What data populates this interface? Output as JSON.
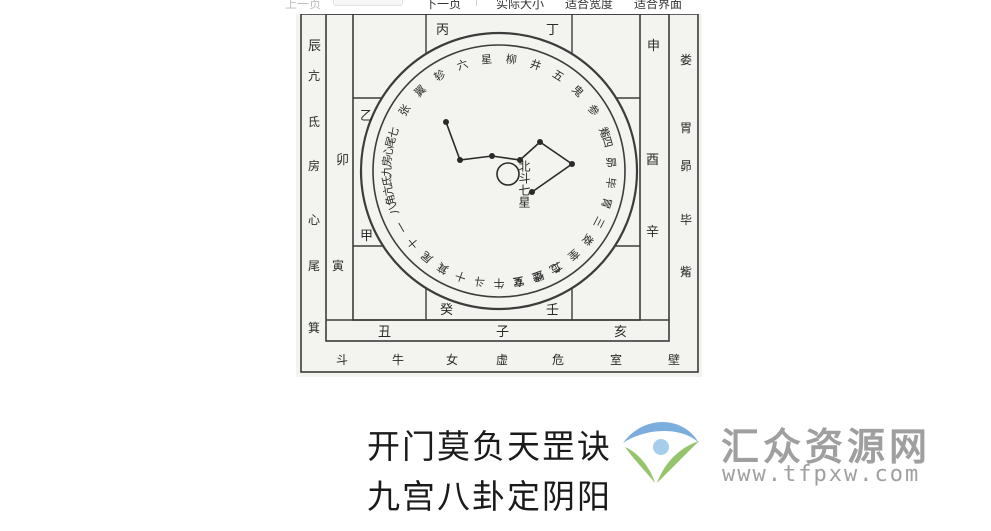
{
  "toolbar": {
    "prev_page": "上一页",
    "next_page": "下一页",
    "actual_size": "实际大小",
    "fit_width": "适合宽度",
    "fit_page": "适合界面"
  },
  "diagram": {
    "top_branch": "丁",
    "top_left_branch": "丙",
    "left_stems": [
      "乙",
      "卯",
      "甲"
    ],
    "right_stems": [
      "酉",
      "辛"
    ],
    "bottom_stems": [
      "丑",
      "子",
      "亥",
      "癸",
      "壬"
    ],
    "top_right_corner": "申",
    "top_left_corner": "辰",
    "left_mansions": [
      "亢",
      "氐",
      "房",
      "心",
      "尾",
      "寅",
      "箕"
    ],
    "right_mansions": [
      "娄",
      "胃",
      "昴",
      "毕",
      "觜"
    ],
    "bottom_mansions": [
      "斗",
      "牛",
      "女",
      "虚",
      "危",
      "室",
      "壁"
    ],
    "ring_top": [
      "七",
      "张",
      "翼",
      "轸",
      "六",
      "星",
      "柳",
      "井",
      "五",
      "鬼",
      "参",
      "觜"
    ],
    "ring_right": [
      "四",
      "昴",
      "毕",
      "胃",
      "三",
      "娄",
      "奎",
      "二",
      "壁",
      "室"
    ],
    "ring_bottom": [
      "危",
      "虚",
      "女",
      "牛",
      "斗",
      "十",
      "箕",
      "尾",
      "十",
      "一"
    ],
    "ring_left": [
      "八",
      "角",
      "亢",
      "氐",
      "九",
      "房",
      "心",
      "尾"
    ],
    "center_label": "北斗七星"
  },
  "caption": {
    "line1": "开门莫负天罡诀",
    "line2": "九宫八卦定阴阳"
  },
  "watermark": {
    "name": "汇众资源网",
    "url": "www.tfpxw.com"
  },
  "colors": {
    "scan_bg": "#f3f3ef",
    "line": "#3c3c3c",
    "text": "#1a1a1a",
    "watermark": "#8f8f8f",
    "logo_blue": "#5b9bd5",
    "logo_green": "#7ab648"
  }
}
